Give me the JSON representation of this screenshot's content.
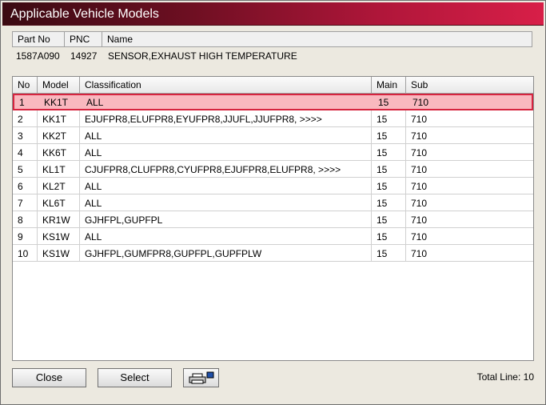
{
  "window": {
    "title": "Applicable Vehicle Models"
  },
  "part": {
    "headers": {
      "part_no": "Part No",
      "pnc": "PNC",
      "name": "Name"
    },
    "values": {
      "part_no": "1587A090",
      "pnc": "14927",
      "name": "SENSOR,EXHAUST HIGH TEMPERATURE"
    }
  },
  "table": {
    "headers": {
      "no": "No",
      "model": "Model",
      "classification": "Classification",
      "main": "Main",
      "sub": "Sub"
    },
    "rows": [
      {
        "no": "1",
        "model": "KK1T",
        "classification": "ALL",
        "main": "15",
        "sub": "710"
      },
      {
        "no": "2",
        "model": "KK1T",
        "classification": "EJUFPR8,ELUFPR8,EYUFPR8,JJUFL,JJUFPR8,  >>>>",
        "main": "15",
        "sub": "710"
      },
      {
        "no": "3",
        "model": "KK2T",
        "classification": "ALL",
        "main": "15",
        "sub": "710"
      },
      {
        "no": "4",
        "model": "KK6T",
        "classification": "ALL",
        "main": "15",
        "sub": "710"
      },
      {
        "no": "5",
        "model": "KL1T",
        "classification": "CJUFPR8,CLUFPR8,CYUFPR8,EJUFPR8,ELUFPR8,  >>>>",
        "main": "15",
        "sub": "710"
      },
      {
        "no": "6",
        "model": "KL2T",
        "classification": "ALL",
        "main": "15",
        "sub": "710"
      },
      {
        "no": "7",
        "model": "KL6T",
        "classification": "ALL",
        "main": "15",
        "sub": "710"
      },
      {
        "no": "8",
        "model": "KR1W",
        "classification": "GJHFPL,GUPFPL",
        "main": "15",
        "sub": "710"
      },
      {
        "no": "9",
        "model": "KS1W",
        "classification": "ALL",
        "main": "15",
        "sub": "710"
      },
      {
        "no": "10",
        "model": "KS1W",
        "classification": "GJHFPL,GUMFPR8,GUPFPL,GUPFPLW",
        "main": "15",
        "sub": "710"
      }
    ]
  },
  "buttons": {
    "close": "Close",
    "select": "Select",
    "print_icon": "printer-icon"
  },
  "footer": {
    "total_line": "Total Line: 10"
  },
  "colors": {
    "title_gradient_end": "#d81f48",
    "selected_row_bg": "#f9b8bf",
    "selected_row_border": "#d6243f"
  }
}
